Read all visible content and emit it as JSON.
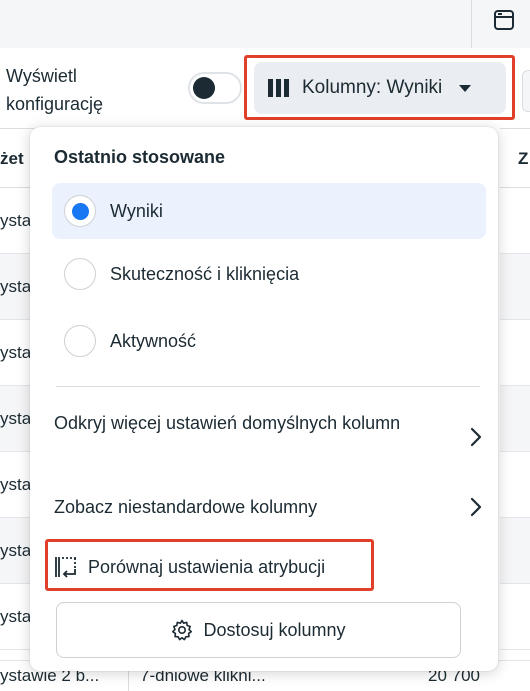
{
  "toolbar": {
    "config_label_line1": "Wyświetl",
    "config_label_line2": "konfigurację",
    "columns_button_label": "Kolumny: Wyniki"
  },
  "table": {
    "header_left": "żet",
    "header_right": "Z",
    "row_left_text": "ysta",
    "bottom_row_col1": "ystawie 2 b...",
    "bottom_row_col2": "7-dniowe klikni...",
    "bottom_row_col3": "20 700"
  },
  "dropdown": {
    "heading": "Ostatnio stosowane",
    "options": [
      {
        "label": "Wyniki",
        "selected": true
      },
      {
        "label": "Skuteczność i kliknięcia",
        "selected": false
      },
      {
        "label": "Aktywność",
        "selected": false
      }
    ],
    "nav_items": [
      {
        "label": "Odkryj więcej ustawień domyślnych kolumn"
      },
      {
        "label": "Zobacz niestandardowe kolumny"
      }
    ],
    "compare_label": "Porównaj ustawienia atrybucji",
    "customize_label": "Dostosuj kolumny"
  },
  "colors": {
    "accent": "#1877f2",
    "highlight_box": "#e0402a",
    "selected_bg": "#ebf2fd",
    "text": "#1c2b33"
  },
  "icons": [
    "panel-icon",
    "columns-icon",
    "caret-down-icon",
    "chevron-right-icon",
    "compare-icon",
    "gear-icon"
  ]
}
